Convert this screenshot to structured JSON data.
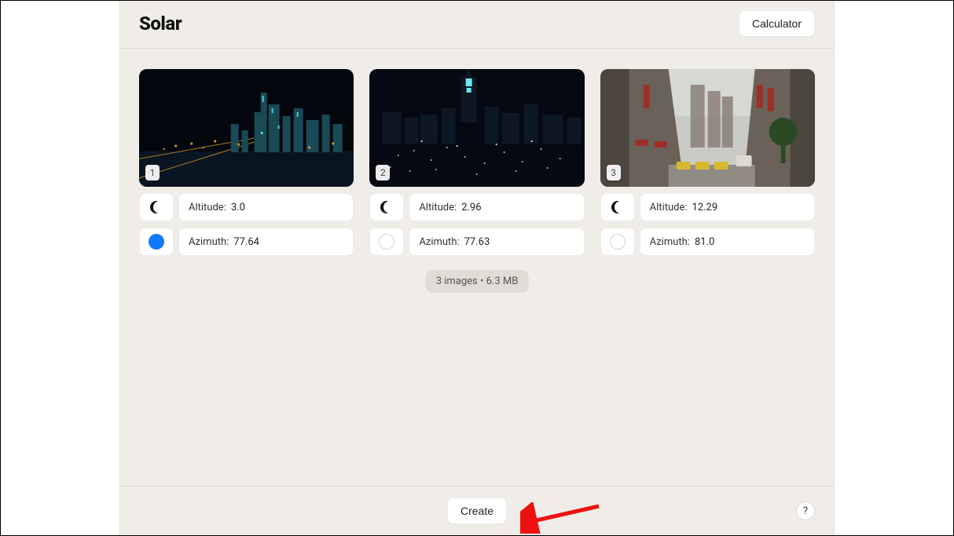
{
  "header": {
    "title": "Solar",
    "calculator_label": "Calculator"
  },
  "cards": [
    {
      "index": "1",
      "altitude_label": "Altitude:",
      "altitude_value": "3.0",
      "azimuth_label": "Azimuth:",
      "azimuth_value": "77.64",
      "primary_filled": true
    },
    {
      "index": "2",
      "altitude_label": "Altitude:",
      "altitude_value": "2.96",
      "azimuth_label": "Azimuth:",
      "azimuth_value": "77.63",
      "primary_filled": false
    },
    {
      "index": "3",
      "altitude_label": "Altitude:",
      "altitude_value": "12.29",
      "azimuth_label": "Azimuth:",
      "azimuth_value": "81.0",
      "primary_filled": false
    }
  ],
  "summary": "3 images • 6.3 MB",
  "footer": {
    "create_label": "Create",
    "help_label": "?"
  }
}
